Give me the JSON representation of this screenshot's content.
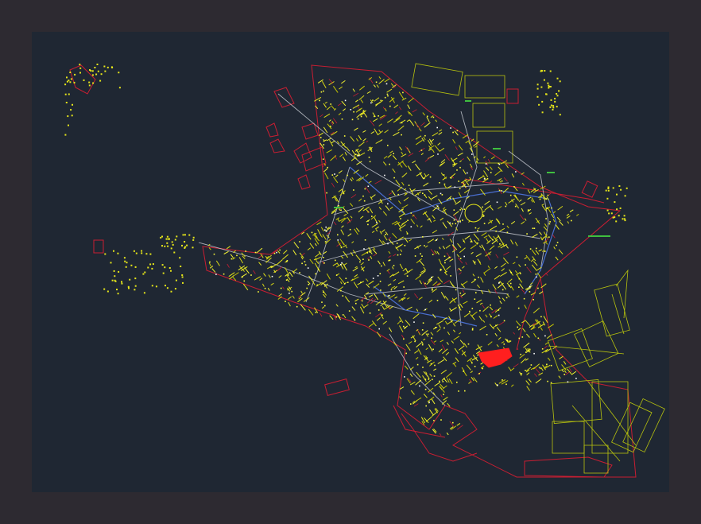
{
  "viewer": {
    "page_background": "#2d2a31",
    "model_space_background": "#1f2733"
  },
  "drawing": {
    "type": "CAD town subdivision plan",
    "layers": [
      {
        "name": "lots",
        "color": "#e6e61a"
      },
      {
        "name": "blocks",
        "color": "#c8c800"
      },
      {
        "name": "boundary",
        "color": "#c81e32"
      },
      {
        "name": "streets",
        "color": "#ffffff"
      },
      {
        "name": "water",
        "color": "#4a6fd0"
      },
      {
        "name": "rural-parcels",
        "color": "#b7c20e"
      },
      {
        "name": "green-marks",
        "color": "#3fbf3f"
      },
      {
        "name": "highlight",
        "color": "#ff1f1f"
      }
    ]
  }
}
